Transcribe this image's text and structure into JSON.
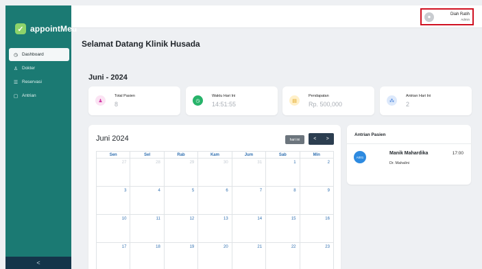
{
  "app": {
    "name": "appointMed"
  },
  "sidebar": {
    "items": [
      {
        "label": "Dashboard",
        "icon": "clock-icon",
        "glyph": "◷"
      },
      {
        "label": "Dokter",
        "icon": "user-icon",
        "glyph": "♙"
      },
      {
        "label": "Reservasi",
        "icon": "list-icon",
        "glyph": "☰"
      },
      {
        "label": "Antrian",
        "icon": "document-icon",
        "glyph": "▢"
      }
    ],
    "collapse_glyph": "<"
  },
  "user": {
    "name": "Diah Ratih",
    "role": "Admin"
  },
  "page": {
    "greeting": "Selamat Datang Klinik Husada",
    "month": "Juni - 2024"
  },
  "stats": [
    {
      "label": "Total Pasien",
      "value": "8",
      "icon": "users-icon",
      "glyph": "👥",
      "bg": "#fbe3f3",
      "fg": "#d33ba6"
    },
    {
      "label": "Waktu Hari Ini",
      "value": "14:51:55",
      "icon": "clock-icon",
      "glyph": "◷",
      "bg": "#27b36a",
      "fg": "#ffffff"
    },
    {
      "label": "Pendapatan",
      "value": "Rp. 500,000",
      "icon": "wallet-icon",
      "glyph": "▤",
      "bg": "#fff0c9",
      "fg": "#e0a21a"
    },
    {
      "label": "Antrian Hari Ini",
      "value": "2",
      "icon": "queue-icon",
      "glyph": "⁂",
      "bg": "#dde9fb",
      "fg": "#2e73d6"
    }
  ],
  "calendar": {
    "title": "Juni 2024",
    "today_label": "hari ini",
    "prev": "<",
    "next": ">",
    "days": [
      "Sen",
      "Sel",
      "Rab",
      "Kam",
      "Jum",
      "Sab",
      "Min"
    ],
    "weeks": [
      [
        {
          "d": "27",
          "m": true
        },
        {
          "d": "28",
          "m": true
        },
        {
          "d": "29",
          "m": true
        },
        {
          "d": "30",
          "m": true
        },
        {
          "d": "31",
          "m": true
        },
        {
          "d": "1",
          "m": false
        },
        {
          "d": "2",
          "m": false
        }
      ],
      [
        {
          "d": "3",
          "m": false
        },
        {
          "d": "4",
          "m": false
        },
        {
          "d": "5",
          "m": false
        },
        {
          "d": "6",
          "m": false
        },
        {
          "d": "7",
          "m": false
        },
        {
          "d": "8",
          "m": false
        },
        {
          "d": "9",
          "m": false
        }
      ],
      [
        {
          "d": "10",
          "m": false
        },
        {
          "d": "11",
          "m": false
        },
        {
          "d": "12",
          "m": false
        },
        {
          "d": "13",
          "m": false
        },
        {
          "d": "14",
          "m": false
        },
        {
          "d": "15",
          "m": false
        },
        {
          "d": "16",
          "m": false
        }
      ],
      [
        {
          "d": "17",
          "m": false
        },
        {
          "d": "18",
          "m": false
        },
        {
          "d": "19",
          "m": false
        },
        {
          "d": "20",
          "m": false
        },
        {
          "d": "21",
          "m": false
        },
        {
          "d": "22",
          "m": false
        },
        {
          "d": "23",
          "m": false
        }
      ]
    ]
  },
  "queue": {
    "title": "Antrian Pasien",
    "items": [
      {
        "code": "A001",
        "name": "Manik Mahardika",
        "doctor": "Dr. Mahalini",
        "time": "17:00"
      }
    ]
  },
  "colors": {
    "sidebar": "#1b7a73",
    "accent": "#2f6fb0",
    "highlight": "#d01020"
  }
}
